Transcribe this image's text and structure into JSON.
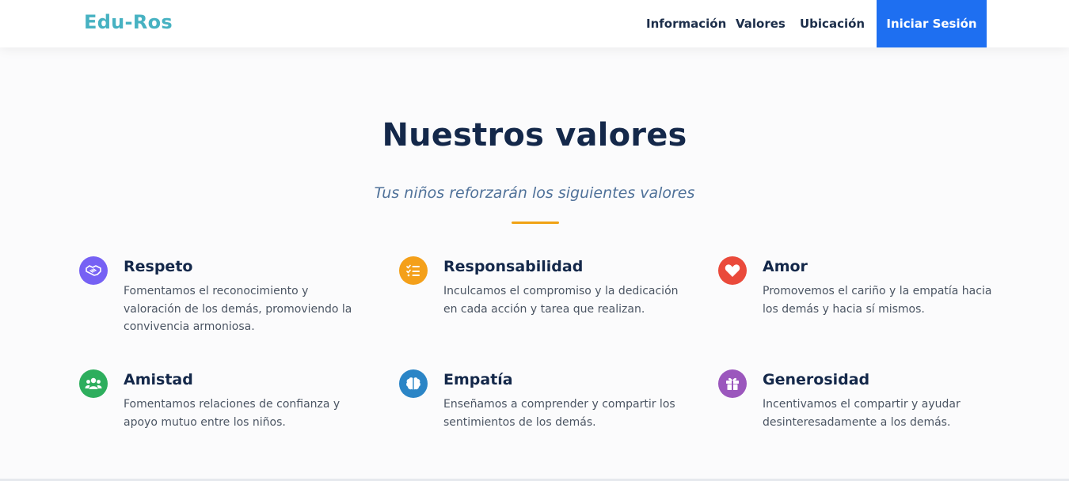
{
  "header": {
    "logo": "Edu-Ros",
    "nav": [
      "Información",
      "Valores",
      "Ubicación"
    ],
    "login_label": "Iniciar Sesión"
  },
  "section": {
    "title": "Nuestros valores",
    "subtitle": "Tus niños reforzarán los siguientes valores"
  },
  "values": [
    {
      "title": "Respeto",
      "description": "Fomentamos el reconocimiento y valoración de los demás, promoviendo la convivencia armoniosa.",
      "icon": "handshake-icon",
      "color": "#7661f4"
    },
    {
      "title": "Responsabilidad",
      "description": "Inculcamos el compromiso y la dedicación en cada acción y tarea que realizan.",
      "icon": "task-list-icon",
      "color": "#f4a01a"
    },
    {
      "title": "Amor",
      "description": "Promovemos el cariño y la empatía hacia los demás y hacia sí mismos.",
      "icon": "heart-icon",
      "color": "#ea4a3b"
    },
    {
      "title": "Amistad",
      "description": "Fomentamos relaciones de confianza y apoyo mutuo entre los niños.",
      "icon": "users-icon",
      "color": "#2dae5d"
    },
    {
      "title": "Empatía",
      "description": "Enseñamos a comprender y compartir los sentimientos de los demás.",
      "icon": "brain-icon",
      "color": "#2b85c6"
    },
    {
      "title": "Generosidad",
      "description": "Incentivamos el compartir y ayudar desinteresadamente a los demás.",
      "icon": "gift-icon",
      "color": "#9b57bd"
    }
  ],
  "colors": {
    "logo": "#47b2c2",
    "primary": "#1e6ff1",
    "heading": "#14284a",
    "accent": "#f0a215"
  }
}
